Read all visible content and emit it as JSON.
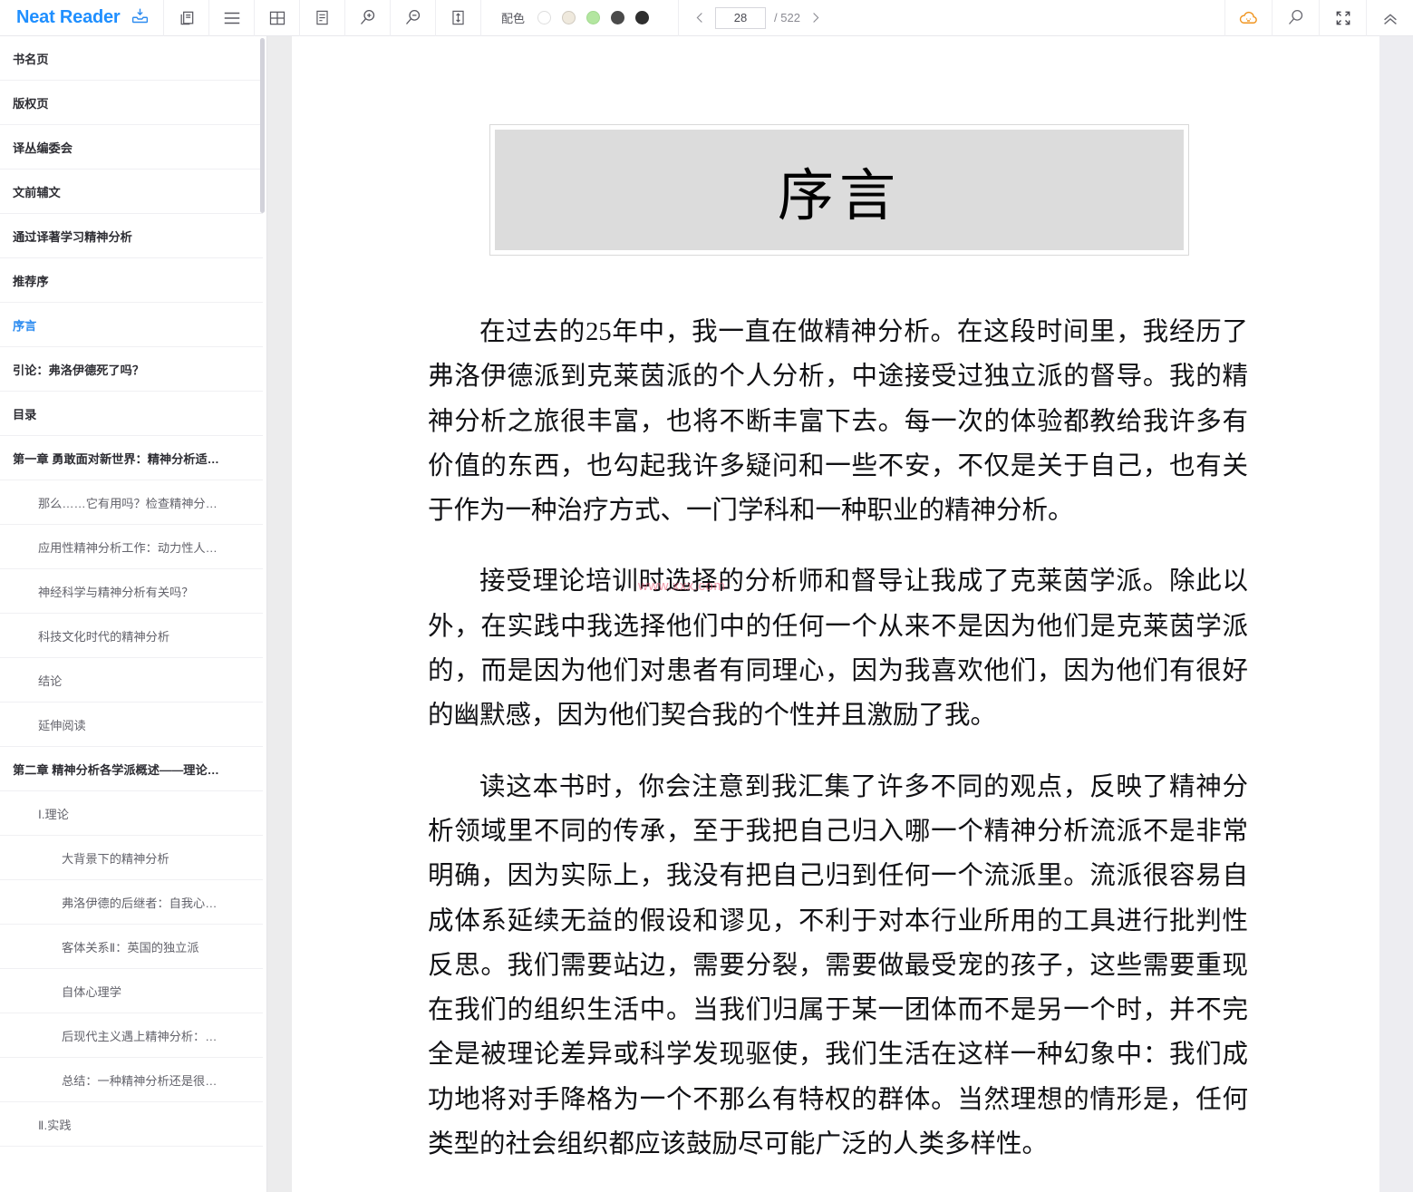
{
  "app": {
    "brand": "Neat Reader"
  },
  "toolbar": {
    "icons": [
      {
        "name": "download-library-icon",
        "label": "下载"
      },
      {
        "name": "copy-pages-icon",
        "label": "双页"
      },
      {
        "name": "menu-icon",
        "label": "目录"
      },
      {
        "name": "grid-layout-icon",
        "label": "排版"
      },
      {
        "name": "notes-icon",
        "label": "笔记"
      },
      {
        "name": "zoom-in-icon",
        "label": "放大"
      },
      {
        "name": "zoom-out-icon",
        "label": "缩小"
      },
      {
        "name": "line-height-icon",
        "label": "行距"
      }
    ],
    "color_scheme": {
      "label": "配色",
      "swatches": [
        {
          "name": "swatch-white",
          "color": "#ffffff",
          "selected": false
        },
        {
          "name": "swatch-cream",
          "color": "#efe9dd",
          "selected": false
        },
        {
          "name": "swatch-green",
          "color": "#b3e6a0",
          "selected": false
        },
        {
          "name": "swatch-gray",
          "color": "#4a4a4a",
          "selected": false
        },
        {
          "name": "swatch-black",
          "color": "#2e2e2e",
          "selected": false
        }
      ]
    },
    "pager": {
      "prev_label": "‹",
      "next_label": "›",
      "current_page": "28",
      "total_label": "/ 522"
    },
    "right_icons": [
      {
        "name": "cloud-sync-icon",
        "color": "#f0941e"
      },
      {
        "name": "search-icon",
        "color": "#6a6a72"
      },
      {
        "name": "fullscreen-icon",
        "color": "#4a4a52"
      },
      {
        "name": "collapse-toolbar-icon",
        "color": "#6a6a72"
      }
    ]
  },
  "sidebar": {
    "items": [
      {
        "label": "书名页",
        "level": 1,
        "active": false
      },
      {
        "label": "版权页",
        "level": 1,
        "active": false
      },
      {
        "label": "译丛编委会",
        "level": 1,
        "active": false
      },
      {
        "label": "文前辅文",
        "level": 1,
        "active": false
      },
      {
        "label": "通过译著学习精神分析",
        "level": 1,
        "active": false
      },
      {
        "label": "推荐序",
        "level": 1,
        "active": false
      },
      {
        "label": "序言",
        "level": 1,
        "active": true
      },
      {
        "label": "引论：弗洛伊德死了吗？",
        "level": 1,
        "active": false
      },
      {
        "label": "目录",
        "level": 1,
        "active": false
      },
      {
        "label": "第一章 勇敢面对新世界：精神分析适…",
        "level": 1,
        "active": false
      },
      {
        "label": "那么……它有用吗？检查精神分…",
        "level": 2,
        "active": false
      },
      {
        "label": "应用性精神分析工作：动力性人…",
        "level": 2,
        "active": false
      },
      {
        "label": "神经科学与精神分析有关吗？",
        "level": 2,
        "active": false
      },
      {
        "label": "科技文化时代的精神分析",
        "level": 2,
        "active": false
      },
      {
        "label": "结论",
        "level": 2,
        "active": false
      },
      {
        "label": "延伸阅读",
        "level": 2,
        "active": false
      },
      {
        "label": "第二章 精神分析各学派概述——理论…",
        "level": 1,
        "active": false
      },
      {
        "label": "Ⅰ.理论",
        "level": 2,
        "active": false
      },
      {
        "label": "大背景下的精神分析",
        "level": 3,
        "active": false
      },
      {
        "label": "弗洛伊德的后继者：自我心…",
        "level": 3,
        "active": false
      },
      {
        "label": "客体关系Ⅱ：英国的独立派",
        "level": 3,
        "active": false
      },
      {
        "label": "自体心理学",
        "level": 3,
        "active": false
      },
      {
        "label": "后现代主义遇上精神分析：…",
        "level": 3,
        "active": false
      },
      {
        "label": "总结：一种精神分析还是很…",
        "level": 3,
        "active": false
      },
      {
        "label": "Ⅱ.实践",
        "level": 2,
        "active": false
      }
    ]
  },
  "reader": {
    "chapter_title": "序言",
    "watermark": "www.xxx.com",
    "paragraphs": [
      "在过去的25年中，我一直在做精神分析。在这段时间里，我经历了弗洛伊德派到克莱茵派的个人分析，中途接受过独立派的督导。我的精神分析之旅很丰富，也将不断丰富下去。每一次的体验都教给我许多有价值的东西，也勾起我许多疑问和一些不安，不仅是关于自己，也有关于作为一种治疗方式、一门学科和一种职业的精神分析。",
      "接受理论培训时选择的分析师和督导让我成了克莱茵学派。除此以外，在实践中我选择他们中的任何一个从来不是因为他们是克莱茵学派的，而是因为他们对患者有同理心，因为我喜欢他们，因为他们有很好的幽默感，因为他们契合我的个性并且激励了我。",
      "读这本书时，你会注意到我汇集了许多不同的观点，反映了精神分析领域里不同的传承，至于我把自己归入哪一个精神分析流派不是非常明确，因为实际上，我没有把自己归到任何一个流派里。流派很容易自成体系延续无益的假设和谬见，不利于对本行业所用的工具进行批判性反思。我们需要站边，需要分裂，需要做最受宠的孩子，这些需要重现在我们的组织生活中。当我们归属于某一团体而不是另一个时，并不完全是被理论差异或科学发现驱使，我们生活在这样一种幻象中：我们成功地将对手降格为一个不那么有特权的群体。当然理想的情形是，任何类型的社会组织都应该鼓励尽可能广泛的人类多样性。"
    ]
  }
}
